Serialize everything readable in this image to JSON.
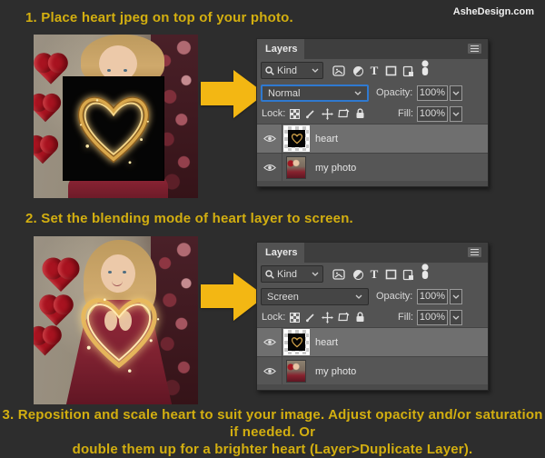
{
  "page": {
    "background": "#2d2d2d",
    "watermark": "AsheDesign.com",
    "steps": {
      "step1": "1.  Place heart jpeg on top of your photo.",
      "step2": "2. Set the blending mode of heart layer to screen.",
      "step3_line1": "3. Reposition and scale heart to suit your image. Adjust opacity and/or saturation if needed. Or",
      "step3_line2": "double them up for a brighter heart (Layer>Duplicate Layer)."
    },
    "colors": {
      "step_text": "#d3af10",
      "arrow": "#f3b713",
      "blend_highlight_border": "#2f79d0",
      "panel_bg": "#535353",
      "selected_row_bg": "#6f6f6f",
      "gold_heart": "#f0c46a",
      "sequin_heart_red": "#a81320"
    },
    "icons": {
      "type_filter_glyph": "T",
      "menu_glyph": "hamburger-bars",
      "search_glyph": "magnifier",
      "chevron_glyph": "v"
    }
  },
  "photos": {
    "photo1_alt": "photo of girl with black heart jpeg square placed on top",
    "photo2_alt": "photo of girl with gold heart blended over her using screen mode"
  },
  "panel1": {
    "title": "Layers",
    "filter": {
      "label": "Kind"
    },
    "blend": {
      "mode": "Normal",
      "highlighted": true
    },
    "opacity": {
      "label": "Opacity:",
      "value": "100%"
    },
    "lock": {
      "label": "Lock:"
    },
    "fill": {
      "label": "Fill:",
      "value": "100%"
    },
    "layers": [
      {
        "name": "heart",
        "selected": true,
        "visible": true
      },
      {
        "name": "my photo",
        "selected": false,
        "visible": true
      }
    ]
  },
  "panel2": {
    "title": "Layers",
    "filter": {
      "label": "Kind"
    },
    "blend": {
      "mode": "Screen",
      "highlighted": false
    },
    "opacity": {
      "label": "Opacity:",
      "value": "100%"
    },
    "lock": {
      "label": "Lock:"
    },
    "fill": {
      "label": "Fill:",
      "value": "100%"
    },
    "layers": [
      {
        "name": "heart",
        "selected": true,
        "visible": true
      },
      {
        "name": "my photo",
        "selected": false,
        "visible": true
      }
    ]
  }
}
